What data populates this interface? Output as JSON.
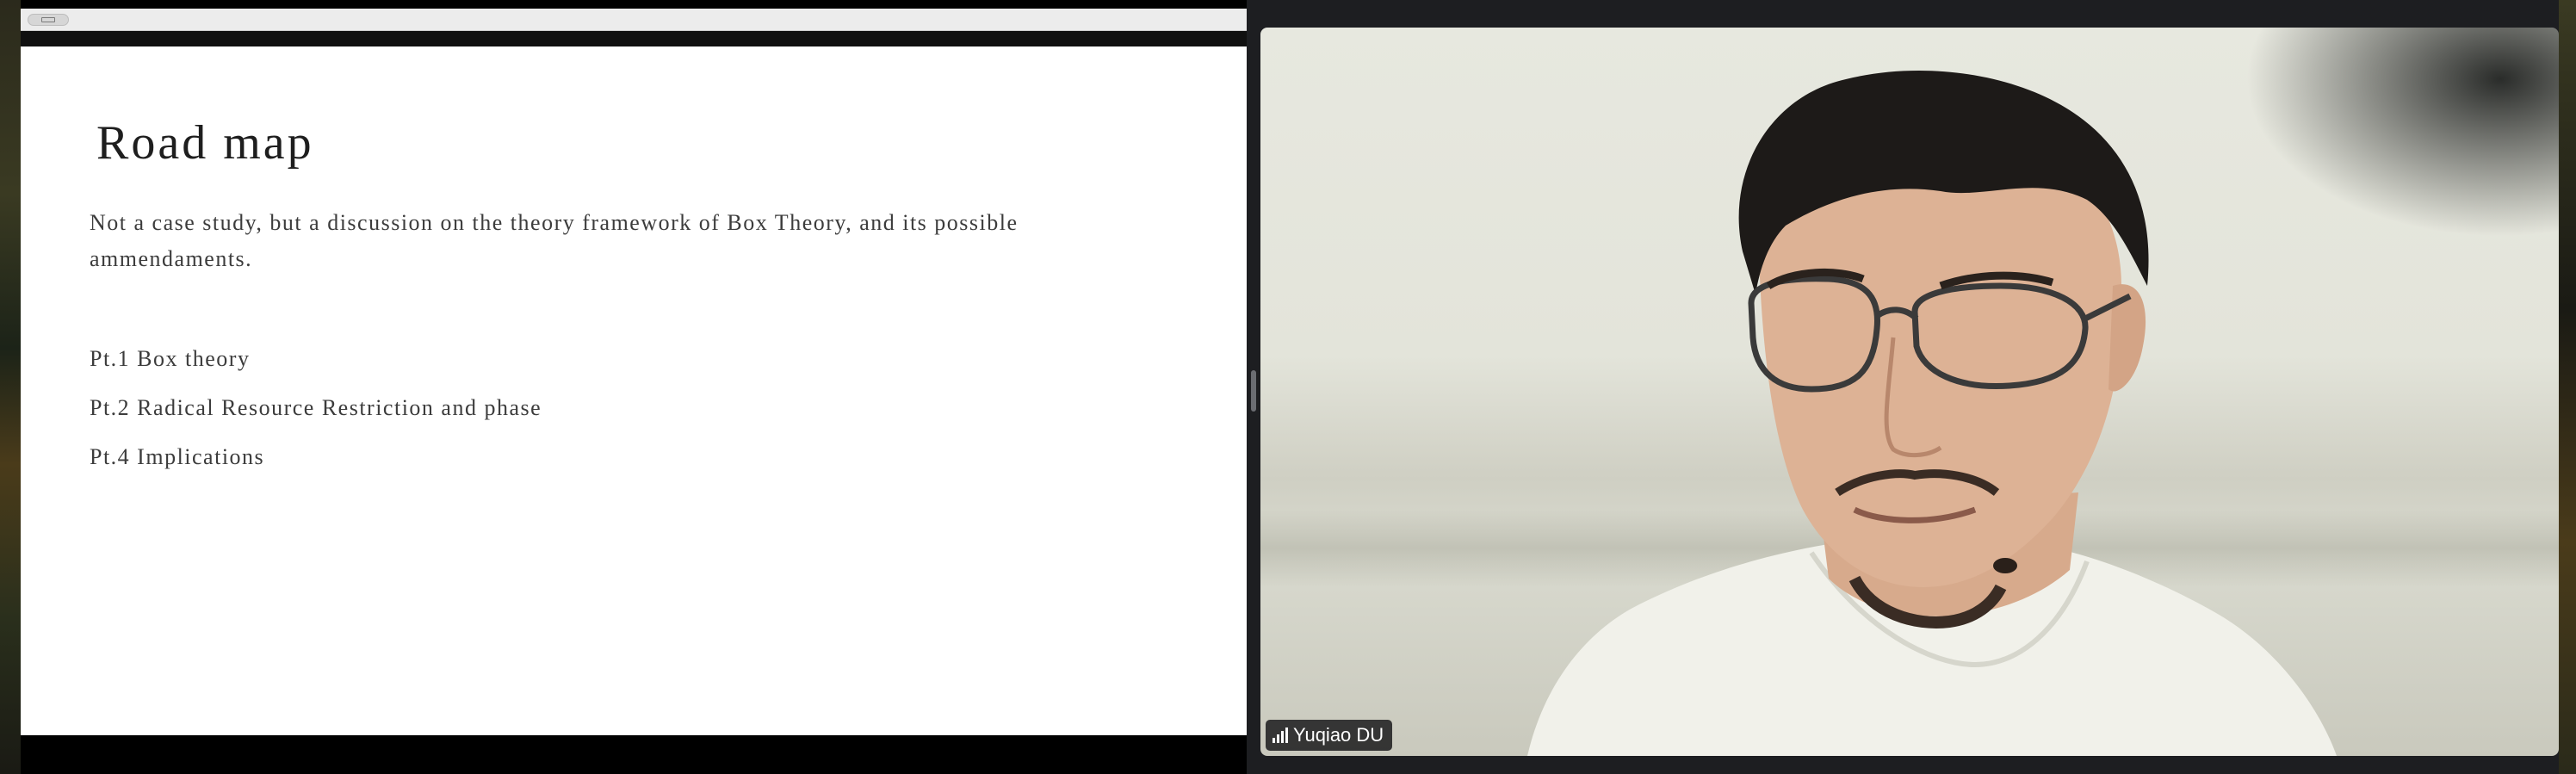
{
  "slide": {
    "title": "Road map",
    "intro": "Not a case study, but a discussion on the theory framework of Box Theory, and its possible ammendaments.",
    "items": [
      {
        "label": "Pt.1 Box theory"
      },
      {
        "label": "Pt.2 Radical Resource Restriction and phase"
      },
      {
        "label": "Pt.4 Implications"
      }
    ]
  },
  "video": {
    "participant_name": "Yuqiao DU",
    "signal_icon": "signal-bars-icon"
  },
  "colors": {
    "app_background": "#1b1c1f",
    "slide_background": "#ffffff",
    "slide_text": "#3c3c3c",
    "name_tag_background": "#141416"
  }
}
